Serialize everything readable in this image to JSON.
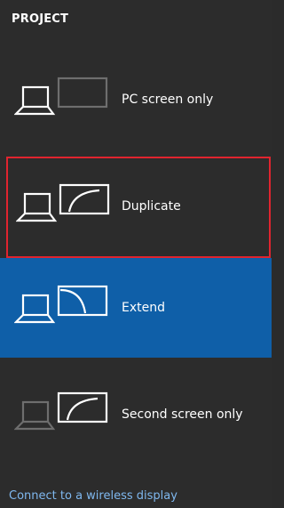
{
  "header": {
    "title": "PROJECT"
  },
  "options": [
    {
      "label": "PC screen only"
    },
    {
      "label": "Duplicate"
    },
    {
      "label": "Extend"
    },
    {
      "label": "Second screen only"
    }
  ],
  "footer": {
    "link": "Connect to a wireless display"
  },
  "colors": {
    "background": "#2c2c2c",
    "selected_background": "#0f5fa8",
    "focus_border": "#e0242f",
    "link": "#7fb8ef",
    "dim_icon": "#6e6e6e"
  },
  "icons": [
    "laptop-icon",
    "monitor-icon"
  ]
}
